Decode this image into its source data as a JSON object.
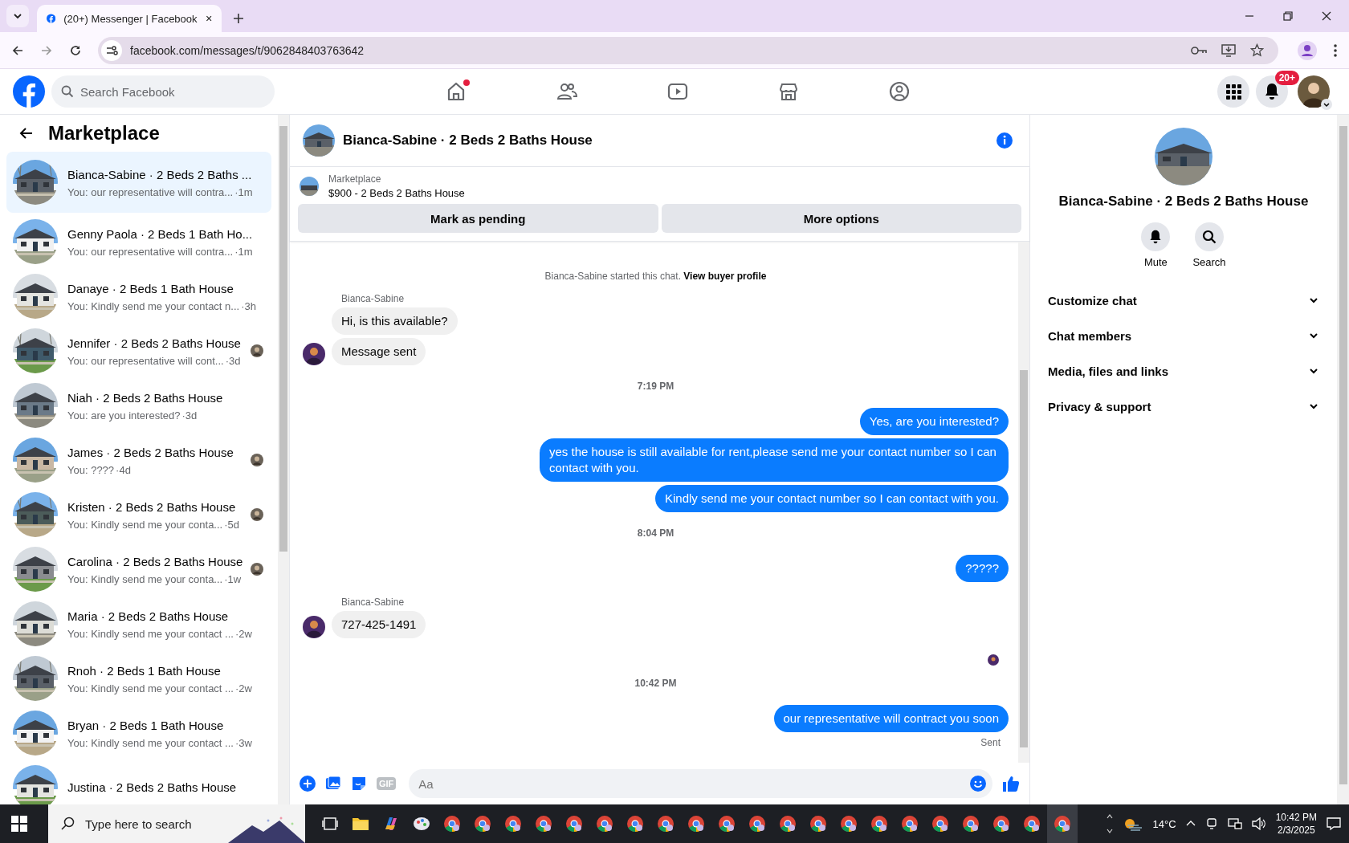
{
  "browser": {
    "tab_title": "(20+) Messenger | Facebook",
    "url": "facebook.com/messages/t/9062848403763642"
  },
  "header": {
    "search_placeholder": "Search Facebook",
    "nav": [
      {
        "kind": "home",
        "dot": true
      },
      {
        "kind": "friends",
        "dot": false
      },
      {
        "kind": "video",
        "dot": false
      },
      {
        "kind": "marketplace",
        "dot": false
      },
      {
        "kind": "groups",
        "dot": false
      }
    ],
    "badge": "20+"
  },
  "sidebar": {
    "title": "Marketplace",
    "conversations": [
      {
        "name": "Bianca-Sabine · 2 Beds 2 Baths ...",
        "preview": "You: our representative will contra...",
        "time": "·1m",
        "selected": true,
        "seen": false
      },
      {
        "name": "Genny Paola · 2 Beds 1 Bath Ho...",
        "preview": "You: our representative will contra...",
        "time": "·1m",
        "selected": false,
        "seen": false
      },
      {
        "name": "Danaye · 2 Beds 1 Bath House",
        "preview": "You: Kindly send me your contact n...",
        "time": "·3h",
        "selected": false,
        "seen": false
      },
      {
        "name": "Jennifer · 2 Beds 2 Baths House",
        "preview": "You: our representative will cont...",
        "time": "·3d",
        "selected": false,
        "seen": true
      },
      {
        "name": "Niah · 2 Beds 2 Baths House",
        "preview": "You: are you interested?",
        "time": "·3d",
        "selected": false,
        "seen": false
      },
      {
        "name": "James · 2 Beds 2 Baths House",
        "preview": "You: ????",
        "time": "·4d",
        "selected": false,
        "seen": true
      },
      {
        "name": "Kristen · 2 Beds 2 Baths House",
        "preview": "You: Kindly send me your conta...",
        "time": "·5d",
        "selected": false,
        "seen": true
      },
      {
        "name": "Carolina · 2 Beds 2 Baths House",
        "preview": "You: Kindly send me your conta...",
        "time": "·1w",
        "selected": false,
        "seen": true
      },
      {
        "name": "Maria · 2 Beds 2 Baths House",
        "preview": "You: Kindly send me your contact ...",
        "time": "·2w",
        "selected": false,
        "seen": false
      },
      {
        "name": "Rnoh · 2 Beds 1 Bath House",
        "preview": "You: Kindly send me your contact ...",
        "time": "·2w",
        "selected": false,
        "seen": false
      },
      {
        "name": "Bryan · 2 Beds 1 Bath House",
        "preview": "You: Kindly send me your contact ...",
        "time": "·3w",
        "selected": false,
        "seen": false
      },
      {
        "name": "Justina · 2 Beds 2 Baths House",
        "selected": false,
        "seen": false
      }
    ]
  },
  "chat": {
    "title": "Bianca-Sabine · 2 Beds 2 Baths House",
    "listing": {
      "label": "Marketplace",
      "title": "$900 - 2 Beds 2 Baths House"
    },
    "buttons": [
      "Mark as pending",
      "More options"
    ],
    "messages": [
      {
        "kind": "system",
        "text": "Bianca-Sabine started this chat.",
        "link": "View buyer profile"
      },
      {
        "kind": "sender",
        "text": "Bianca-Sabine"
      },
      {
        "kind": "incoming",
        "text": "Hi, is this available?",
        "avatar": false
      },
      {
        "kind": "incoming",
        "text": "Message sent",
        "avatar": true
      },
      {
        "kind": "time",
        "text": "7:19 PM"
      },
      {
        "kind": "outgoing",
        "text": "Yes, are you interested?"
      },
      {
        "kind": "outgoing",
        "text": "yes the house is still available for rent,please send me your contact number so I can contact with you."
      },
      {
        "kind": "outgoing",
        "text": "Kindly send me your contact number so I can contact with you."
      },
      {
        "kind": "time",
        "text": "8:04 PM"
      },
      {
        "kind": "outgoing",
        "text": "?????"
      },
      {
        "kind": "sender",
        "text": "Bianca-Sabine"
      },
      {
        "kind": "incoming",
        "text": "727-425-1491",
        "avatar": true
      },
      {
        "kind": "seen"
      },
      {
        "kind": "time",
        "text": "10:42 PM"
      },
      {
        "kind": "outgoing",
        "text": "our representative will contract you soon"
      },
      {
        "kind": "status",
        "text": "Sent"
      }
    ],
    "composer": {
      "gif": "GIF",
      "placeholder": "Aa"
    }
  },
  "details": {
    "title": "Bianca-Sabine · 2 Beds 2 Baths House",
    "actions": [
      {
        "kind": "mute",
        "label": "Mute"
      },
      {
        "kind": "search",
        "label": "Search"
      }
    ],
    "sections": [
      "Customize chat",
      "Chat members",
      "Media, files and links",
      "Privacy & support"
    ]
  },
  "taskbar": {
    "search_placeholder": "Type here to search",
    "apps": [
      {
        "kind": "task-view",
        "selected": false
      },
      {
        "kind": "folder",
        "selected": false
      },
      {
        "kind": "copilot",
        "selected": false
      },
      {
        "kind": "paint",
        "selected": false
      },
      {
        "kind": "browser",
        "selected": false
      },
      {
        "kind": "browser",
        "selected": false
      },
      {
        "kind": "browser",
        "selected": false
      },
      {
        "kind": "browser",
        "selected": false
      },
      {
        "kind": "browser",
        "selected": false
      },
      {
        "kind": "browser",
        "selected": false
      },
      {
        "kind": "browser",
        "selected": false
      },
      {
        "kind": "browser",
        "selected": false
      },
      {
        "kind": "browser",
        "selected": false
      },
      {
        "kind": "browser",
        "selected": false
      },
      {
        "kind": "browser",
        "selected": false
      },
      {
        "kind": "browser",
        "selected": false
      },
      {
        "kind": "browser",
        "selected": false
      },
      {
        "kind": "browser",
        "selected": false
      },
      {
        "kind": "browser",
        "selected": false
      },
      {
        "kind": "browser",
        "selected": false
      },
      {
        "kind": "browser",
        "selected": false
      },
      {
        "kind": "browser",
        "selected": false
      },
      {
        "kind": "browser",
        "selected": false
      },
      {
        "kind": "browser",
        "selected": false
      },
      {
        "kind": "browser",
        "selected": true
      }
    ],
    "weather": "14°C",
    "time": "10:42 PM",
    "date": "2/3/2025"
  }
}
